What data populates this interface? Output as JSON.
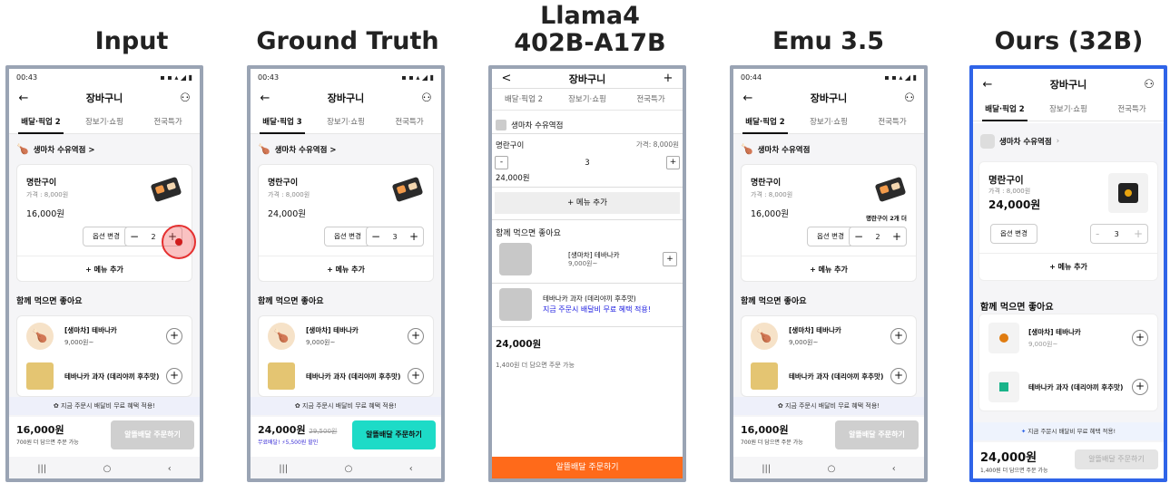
{
  "headers": [
    "Input",
    "Ground Truth",
    "Llama4\n402B-A17B",
    "Emu 3.5",
    "Ours (32B)"
  ],
  "headers_lines": {
    "h0": "Input",
    "h1": "Ground Truth",
    "h2a": "Llama4",
    "h2b": "402B-A17B",
    "h3": "Emu 3.5",
    "h4": "Ours (32B)"
  },
  "input": {
    "status_time": "00:43",
    "title": "장바구니",
    "tabs": [
      "배달·픽업 2",
      "장보기·쇼핑",
      "전국특가"
    ],
    "store": "생마차 수유역점 >",
    "item_name": "명란구이",
    "item_price_label": "가격 : 8,000원",
    "item_total": "16,000원",
    "option_btn": "옵션 변경",
    "qty": "2",
    "add_menu": "+ 메뉴 추가",
    "section": "함께 먹으면 좋아요",
    "rec1_name": "[생마차] 테바나카",
    "rec1_price": "9,000원~",
    "rec2_name": "테바나카 과자 (데리야끼 후추맛)",
    "promo": "지금 주문시 배달비 무료 혜택 적용!",
    "footer_total": "16,000원",
    "footer_note": "700원 더 담으면 주문 가능",
    "footer_btn": "알뜰배달 주문하기"
  },
  "gt": {
    "status_time": "00:43",
    "title": "장바구니",
    "tabs": [
      "배달·픽업 3",
      "장보기·쇼핑",
      "전국특가"
    ],
    "store": "생마차 수유역점 >",
    "item_name": "명란구이",
    "item_price_label": "가격 : 8,000원",
    "item_total": "24,000원",
    "option_btn": "옵션 변경",
    "qty": "3",
    "add_menu": "+ 메뉴 추가",
    "section": "함께 먹으면 좋아요",
    "rec1_name": "[생마차] 테바나카",
    "rec1_price": "9,000원~",
    "rec2_name": "테바나카 과자 (데리야끼 후추맛)",
    "promo": "지금 주문시 배달비 무료 혜택 적용!",
    "footer_total": "24,000원",
    "footer_strike": "29,500원",
    "footer_note": "무료배달! ⚡5,500원 할인",
    "footer_btn": "알뜰배달 주문하기"
  },
  "llama": {
    "back": "<",
    "title": "장바구니",
    "plus": "+",
    "tabs": [
      "배달·픽업 2",
      "장보기·쇼핑",
      "전국특가"
    ],
    "store": "생마차 수유역점",
    "item_name": "명란구이",
    "item_price_label": "가격: 8,000원",
    "minus": "-",
    "qty": "3",
    "item_total": "24,000원",
    "add_menu": "+ 메뉴 추가",
    "section": "함께 먹으면 좋아요",
    "rec1_name": "[생마차] 테바나카",
    "rec1_price": "9,000원~",
    "rec2_name": "테바나카 과자 (데리야끼 후추맛)",
    "rec2_promo": "지금 주문시 배달비 무료 혜택 적용!",
    "total": "24,000원",
    "note": "1,400원 더 담으면 주문 가능",
    "footer_btn": "알뜰배달 주문하기"
  },
  "emu": {
    "status_time": "00:44",
    "title": "장바구니",
    "tabs": [
      "배달·픽업 2",
      "장보기·쇼핑",
      "전국특가"
    ],
    "store": "생마차 수유역점",
    "item_name": "명란구이",
    "item_price_label": "가격 : 8,000원",
    "item_total": "16,000원",
    "item_tag": "명란구이 2개 더",
    "option_btn": "옵션 변경",
    "qty": "2",
    "add_menu": "+ 메뉴 추가",
    "section": "함께 먹으면 좋아요",
    "rec1_name": "[생마차] 테바나카",
    "rec1_price": "9,000원~",
    "rec2_name": "테바나카 과자 (데리야끼 후추맛)",
    "promo": "지금 주문시 배달비 무료 혜택 적용!",
    "footer_total": "16,000원",
    "footer_note": "700원 더 담으면 주문 가능",
    "footer_btn": "알뜰배달 주문하기"
  },
  "ours": {
    "title": "장바구니",
    "tabs": [
      "배달·픽업 2",
      "장보기·쇼핑",
      "전국특가"
    ],
    "store": "생마차 수유역점",
    "item_name": "명란구이",
    "item_price_label": "가격 : 8,000원",
    "item_total": "24,000원",
    "option_btn": "옵션 변경",
    "qty": "3",
    "add_menu": "+ 메뉴 추가",
    "section": "함께 먹으면 좋아요",
    "rec1_name": "[생마차] 테바나카",
    "rec1_price": "9,000원~",
    "rec2_name": "테바나카 과자 (데리야끼 후추맛)",
    "promo": "지금 주문시 배달비 무료 혜택 적용!",
    "footer_total": "24,000원",
    "footer_note": "1,400원 더 담으면 주문 가능",
    "footer_btn": "알뜰배달 주문하기"
  }
}
